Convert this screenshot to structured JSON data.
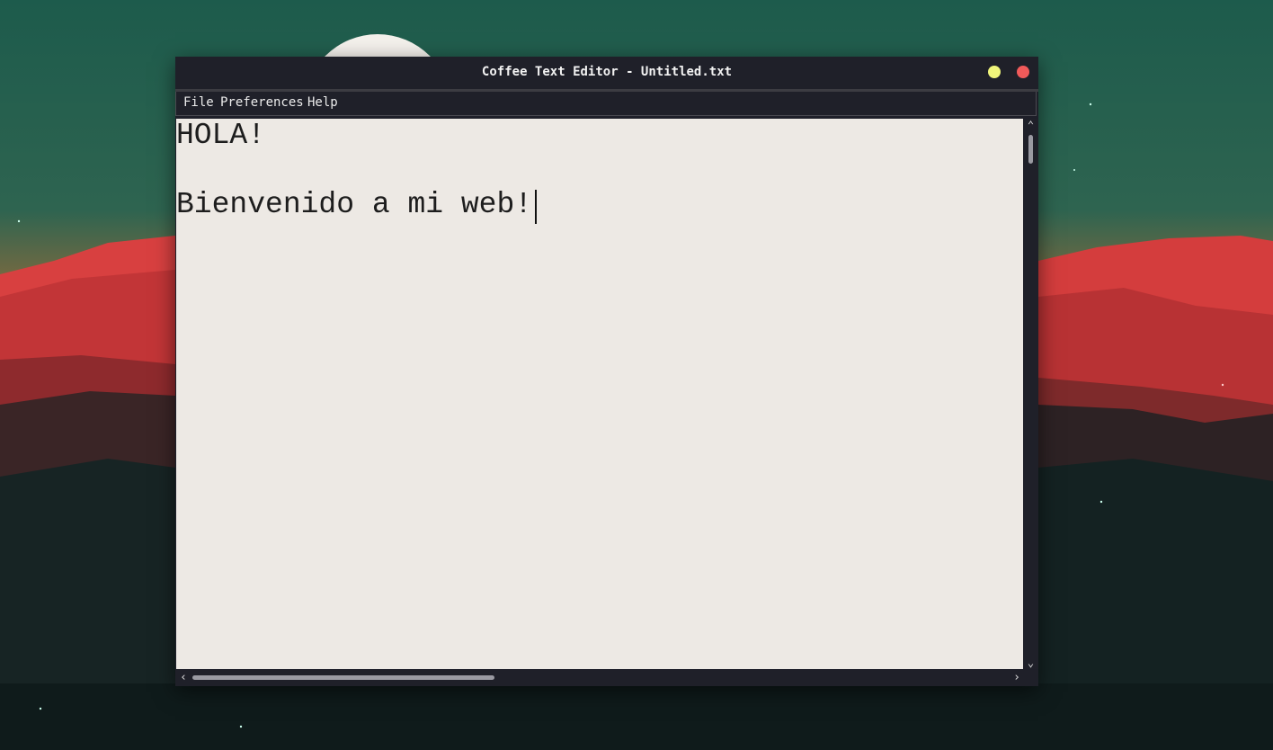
{
  "window": {
    "title": "Coffee Text Editor - Untitled.txt",
    "controls": {
      "minimize_color": "#f0f57b",
      "close_color": "#f15a5a"
    }
  },
  "menubar": {
    "items": [
      "File",
      "Preferences",
      "Help"
    ]
  },
  "editor": {
    "lines": [
      "HOLA!",
      "",
      "Bienvenido a mi web!"
    ],
    "background": "#ede9e4"
  },
  "scrollbars": {
    "up_icon": "chevron-up-icon",
    "down_icon": "chevron-down-icon",
    "left_icon": "chevron-left-icon",
    "right_icon": "chevron-right-icon"
  },
  "colors": {
    "window_chrome": "#1f2029",
    "wallpaper_sky": "#1f5a4c",
    "wallpaper_mountains": "#c4383a"
  }
}
